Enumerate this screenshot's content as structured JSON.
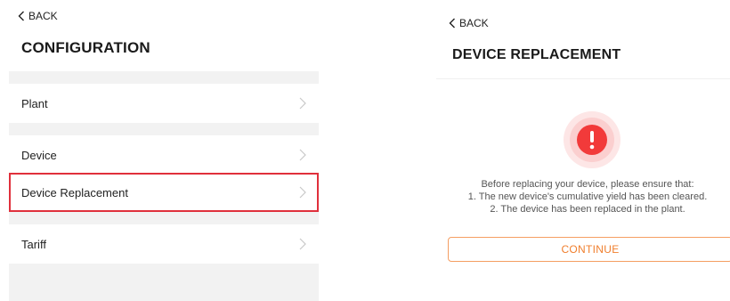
{
  "config_screen": {
    "back_label": "BACK",
    "title": "CONFIGURATION",
    "items": [
      {
        "label": "Plant",
        "icon": "chevron-right-icon"
      },
      {
        "label": "Device",
        "icon": "chevron-right-icon"
      },
      {
        "label": "Device Replacement",
        "icon": "chevron-right-icon",
        "highlighted": true
      },
      {
        "label": "Tariff",
        "icon": "chevron-right-icon"
      }
    ],
    "highlight_color": "#e0303c"
  },
  "replacement_screen": {
    "back_label": "BACK",
    "title": "DEVICE REPLACEMENT",
    "alert_icon": "exclamation-alert-icon",
    "alert_color": "#f23a3a",
    "message_lines": [
      "Before replacing your device, please ensure that:",
      "1. The new device's cumulative yield has been cleared.",
      "2. The device has been replaced in the plant."
    ],
    "continue_label": "CONTINUE",
    "accent_color": "#f07f2e"
  }
}
